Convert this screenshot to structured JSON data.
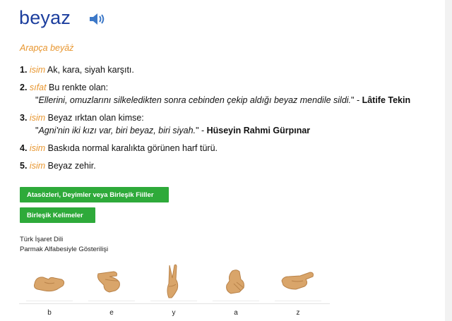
{
  "entry": {
    "word": "beyaz",
    "origin": "Arapça beyāż"
  },
  "definitions": [
    {
      "num": "1.",
      "category": "isim",
      "text": " Ak, kara, siyah karşıtı.",
      "example": "",
      "author": ""
    },
    {
      "num": "2.",
      "category": "sıfat",
      "text": " Bu renkte olan:",
      "example": "Ellerini, omuzlarını silkeledikten sonra cebinden çekip aldığı beyaz mendile sildi.",
      "author": "Lâtife Tekin"
    },
    {
      "num": "3.",
      "category": "isim",
      "text": " Beyaz ırktan olan kimse:",
      "example": "Agni'nin iki kızı var, biri beyaz, biri siyah.",
      "author": "Hüseyin Rahmi Gürpınar"
    },
    {
      "num": "4.",
      "category": "isim",
      "text": " Baskıda normal karalıkta görünen harf türü.",
      "example": "",
      "author": ""
    },
    {
      "num": "5.",
      "category": "isim",
      "text": " Beyaz zehir.",
      "example": "",
      "author": ""
    }
  ],
  "buttons": {
    "idioms": "Atasözleri, Deyimler veya Birleşik Fiiller",
    "compounds": "Birleşik Kelimeler"
  },
  "sign_language": {
    "title_line1": "Türk İşaret Dili",
    "title_line2": "Parmak Alfabesiyle Gösterilişi",
    "letters": [
      "b",
      "e",
      "y",
      "a",
      "z"
    ]
  },
  "colors": {
    "word": "#1d3f9e",
    "category": "#e8962f",
    "button": "#2eaa3a",
    "skin": "#d9a56a"
  },
  "icons": {
    "audio": "speaker-icon"
  }
}
